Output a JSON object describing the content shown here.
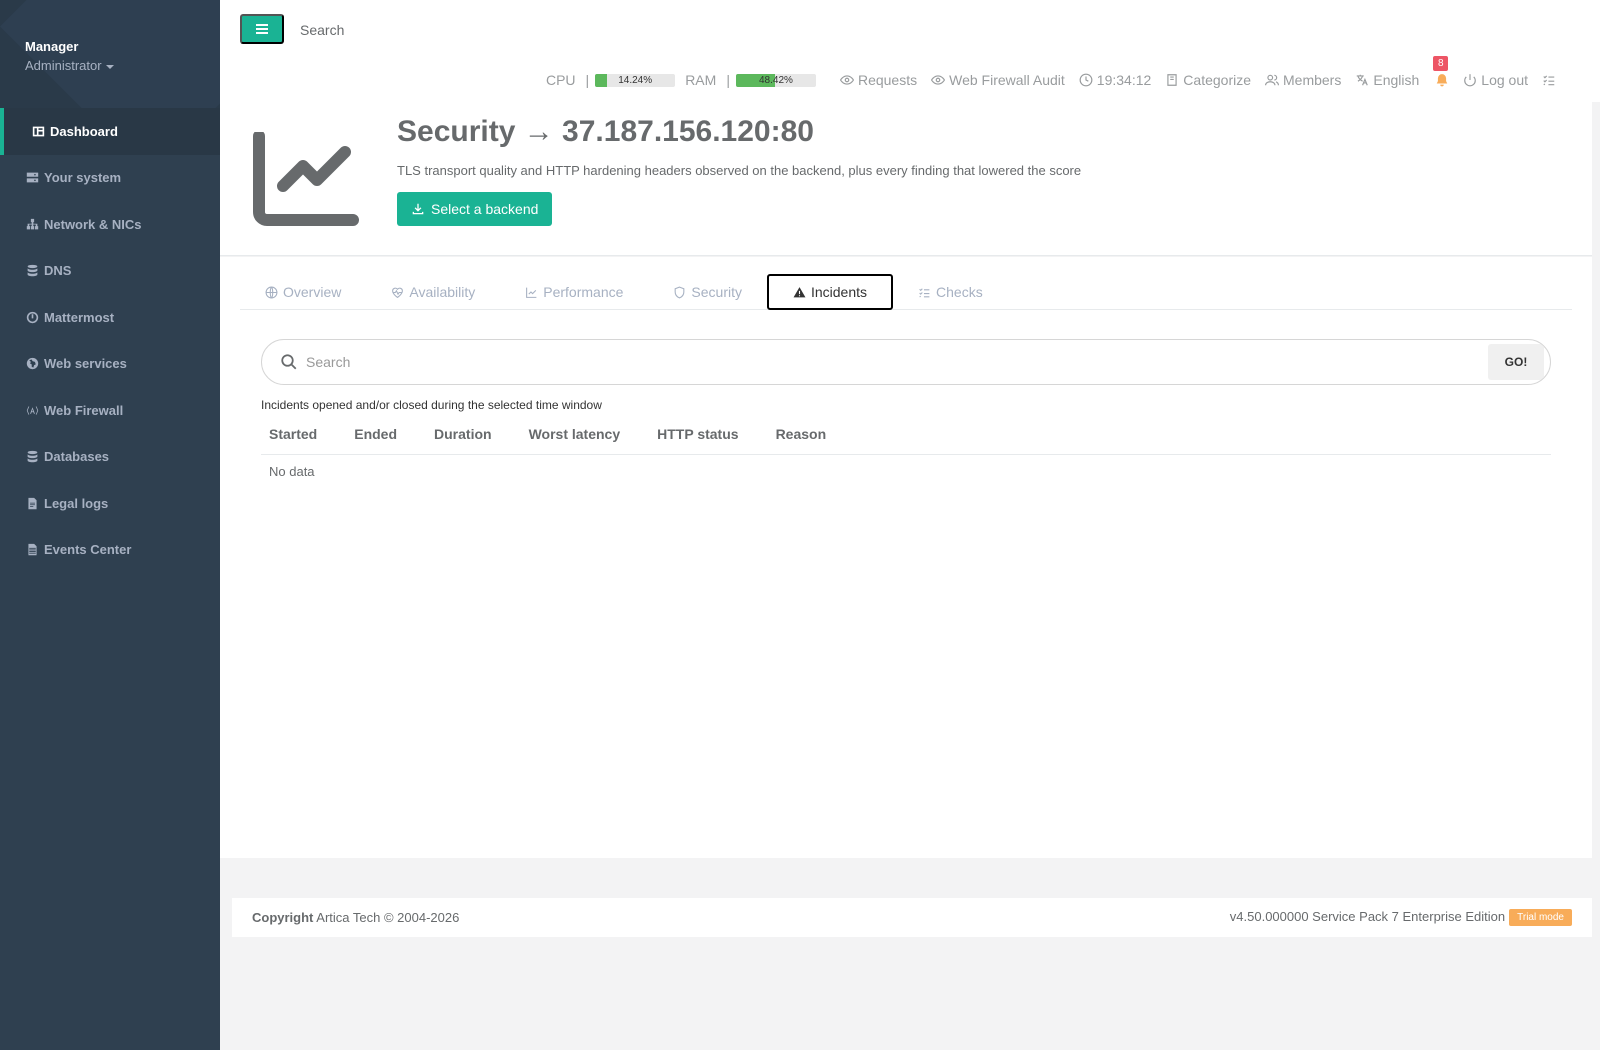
{
  "sidebar": {
    "profile": {
      "name": "Manager",
      "role": "Administrator"
    },
    "items": [
      {
        "label": "Dashboard",
        "icon": "dashboard-icon"
      },
      {
        "label": "Your system",
        "icon": "server-icon"
      },
      {
        "label": "Network & NICs",
        "icon": "network-icon"
      },
      {
        "label": "DNS",
        "icon": "database-icon"
      },
      {
        "label": "Mattermost",
        "icon": "power-icon"
      },
      {
        "label": "Web services",
        "icon": "globe-icon"
      },
      {
        "label": "Web Firewall",
        "icon": "firewall-icon"
      },
      {
        "label": "Databases",
        "icon": "database-icon"
      },
      {
        "label": "Legal logs",
        "icon": "file-icon"
      },
      {
        "label": "Events Center",
        "icon": "events-icon"
      }
    ]
  },
  "topbar": {
    "search_placeholder": "Search",
    "cpu": {
      "label": "CPU",
      "sep": "|",
      "value": "14.24%",
      "fraction": 0.1424
    },
    "ram": {
      "label": "RAM",
      "sep": "|",
      "value": "48.42%",
      "fraction": 0.4842
    },
    "requests": "Requests",
    "waf_audit": "Web Firewall Audit",
    "clock": "19:34:12",
    "categorize": "Categorize",
    "members": "Members",
    "language": "English",
    "notifications_count": "8",
    "logout": "Log out"
  },
  "header": {
    "title": "Security → 37.187.156.120:80",
    "description": "TLS transport quality and HTTP hardening headers observed on the backend, plus every finding that lowered the score",
    "button_label": "Select a backend"
  },
  "tabs": [
    {
      "label": "Overview",
      "icon": "globe-icon"
    },
    {
      "label": "Availability",
      "icon": "heartbeat-icon"
    },
    {
      "label": "Performance",
      "icon": "line-chart-icon"
    },
    {
      "label": "Security",
      "icon": "shield-icon"
    },
    {
      "label": "Incidents",
      "icon": "warning-icon",
      "active": true
    },
    {
      "label": "Checks",
      "icon": "checklist-icon"
    }
  ],
  "search": {
    "placeholder": "Search",
    "go_label": "GO!"
  },
  "table": {
    "caption": "Incidents opened and/or closed during the selected time window",
    "columns": [
      "Started",
      "Ended",
      "Duration",
      "Worst latency",
      "HTTP status",
      "Reason"
    ],
    "empty_text": "No data"
  },
  "footer": {
    "copyright_label": "Copyright",
    "copyright_text": "Artica Tech © 2004-2026",
    "version": "v4.50.000000 Service Pack 7 Enterprise Edition",
    "trial_label": "Trial mode"
  },
  "colors": {
    "accent": "#1ab394",
    "sidebar": "#2f4050",
    "warning": "#f8ac59",
    "danger": "#ed5565",
    "progress": "#5cb85c"
  }
}
